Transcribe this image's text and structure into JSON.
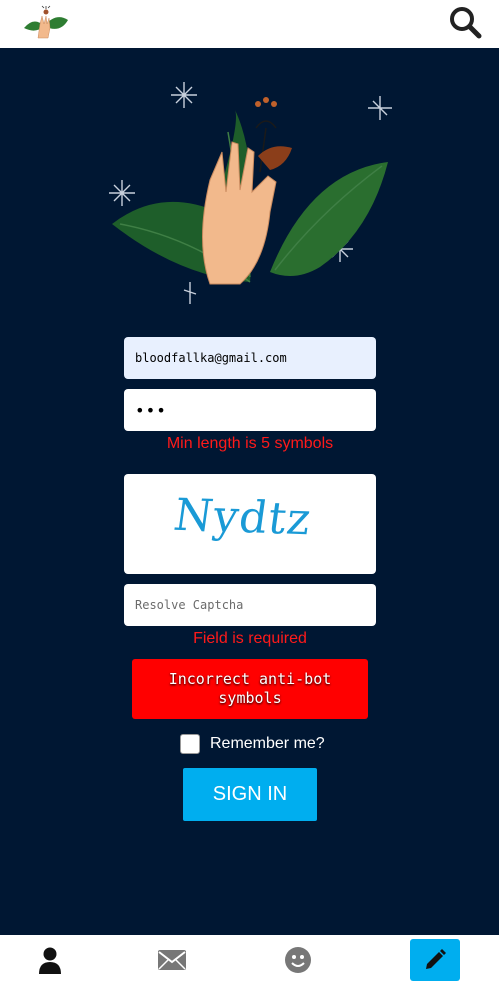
{
  "header": {
    "logo_icon": "hand-leaf-logo-icon",
    "search_icon": "search-icon"
  },
  "hero": {
    "illustration": "hand-holding-flower-illustration"
  },
  "form": {
    "email": {
      "value": "bloodfallka@gmail.com"
    },
    "password": {
      "value": "•••"
    },
    "password_error": "Min length is 5 symbols",
    "captcha": {
      "text": "Nydtz"
    },
    "captcha_input": {
      "placeholder": "Resolve Captcha",
      "value": ""
    },
    "captcha_error": "Field is required",
    "alert": "Incorrect anti-bot symbols",
    "remember_label": "Remember me?",
    "remember_checked": false,
    "submit_label": "SIGN IN"
  },
  "bottom_nav": {
    "items": [
      {
        "icon": "user-icon",
        "active": false
      },
      {
        "icon": "mail-icon",
        "active": false
      },
      {
        "icon": "smile-icon",
        "active": false
      },
      {
        "icon": "pencil-icon",
        "active": true
      }
    ]
  },
  "colors": {
    "background": "#001733",
    "accent": "#00aeef",
    "error": "#ff1a1a",
    "alert": "#ff0000"
  }
}
